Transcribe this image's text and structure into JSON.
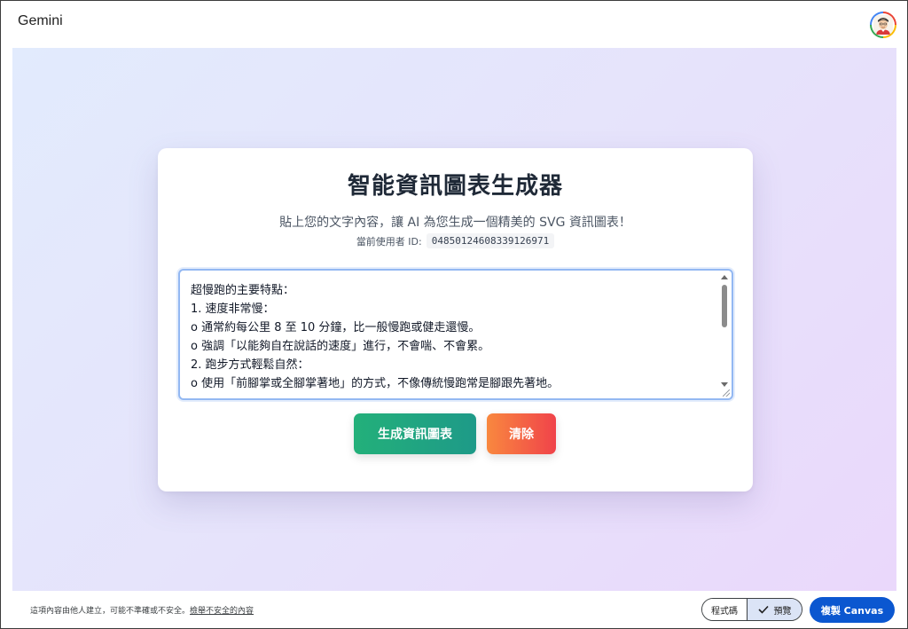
{
  "header": {
    "brand": "Gemini",
    "avatar_icon": "user-avatar-icon"
  },
  "card": {
    "title": "智能資訊圖表生成器",
    "subtitle": "貼上您的文字內容，讓 AI 為您生成一個精美的 SVG 資訊圖表！",
    "userid_label": "當前使用者 ID:",
    "userid_value": "04850124608339126971",
    "textarea_lines": [
      "超慢跑的主要特點：",
      "1. 速度非常慢：",
      "o 通常約每公里 8 至 10 分鐘，比一般慢跑或健走還慢。",
      "o 強調「以能夠自在說話的速度」進行，不會喘、不會累。",
      "2. 跑步方式輕鬆自然：",
      "o 使用「前腳掌或全腳掌著地」的方式，不像傳統慢跑常是腳跟先著地。"
    ],
    "generate_label": "生成資訊圖表",
    "clear_label": "清除",
    "colors": {
      "generate_start": "#23b07a",
      "generate_end": "#1e9a88",
      "clear_start": "#f9883f",
      "clear_end": "#f0434a"
    }
  },
  "footer": {
    "disclaimer": "這項內容由他人建立，可能不準確或不安全。",
    "report_link": "檢舉不安全的內容",
    "code_tab": "程式碼",
    "preview_tab": "預覽",
    "copy_label": "複製 Canvas",
    "accent": "#0b57d0"
  }
}
